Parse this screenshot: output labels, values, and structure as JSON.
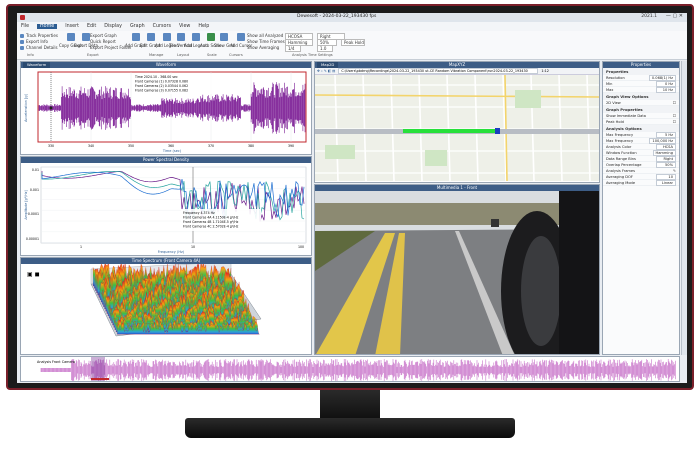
{
  "app": {
    "title": "Dewesoft - 2024-03-22_193430 fps",
    "version": "2021.1",
    "tabs": [
      "File",
      "Home",
      "Insert",
      "Edit",
      "Display",
      "Graph",
      "Cursors",
      "View",
      "Help"
    ],
    "active_tab": "Home"
  },
  "ribbon": {
    "items": [
      "Track Properties",
      "Export Info",
      "Channel Details",
      "Copy Graph",
      "Export Data",
      "Export Graph",
      "Quick Report",
      "Export Project Folder",
      "Add Graph",
      "Edit Graph",
      "Add Legend",
      "Tile Vertical",
      "Add Legend",
      "Auto Scale",
      "Show Grid",
      "Add Cursor",
      "Show all Analyzed Data",
      "Show Time Frames",
      "Show Averaging"
    ],
    "groups": [
      "Info",
      "Export",
      "Manage",
      "Layout",
      "Scale",
      "Cursors",
      "Analysis Time Settings"
    ],
    "dropdowns": [
      "HCOSA",
      "Right",
      "Hamming",
      "50%",
      "Peak Hold",
      "1/4",
      "1.0"
    ]
  },
  "panels": {
    "waveform": {
      "tab": "Waveform",
      "title": "Waveform",
      "ylabel": "Acceleration [g]",
      "xlabel": "Time (sec)",
      "xticks": [
        "330",
        "340",
        "350",
        "360",
        "370",
        "380",
        "390"
      ],
      "info": [
        "Time     2024.10 - 368.00  sec",
        "Front Cameras (1)   0.07328     0.080",
        "Front Cameras (2)   0.03544     0.062",
        "Front Cameras (3)   0.07155     0.082"
      ]
    },
    "psd": {
      "title": "Power Spectral Density",
      "ylabel": "Amplitude [g²/Hz]",
      "xlabel": "Frequency (Hz)",
      "yticks": [
        "0.01",
        "0.001",
        "0.0001",
        "0.00001"
      ],
      "xticks": [
        "1",
        "10",
        "100"
      ],
      "info": [
        "Frequency          4.374 Hz",
        "Front Cameras 4A   4.1150E-4  g²/Hz",
        "Front Cameras 4B   1.7104E-5  g²/Hz",
        "Front Cameras 4C   2.5702E-4  g²/Hz"
      ]
    },
    "waterfall": {
      "title": "Time Spectrum (Front Camera 4A)"
    },
    "map": {
      "tab": "Map2D",
      "title": "MapXYZ",
      "path": "C:\\Users\\pbdrng\\Recordings\\2024-03-22_193430 ut-CE Random Vibration Component\\run2024-03-22_193430",
      "zoom": "1:12"
    },
    "video": {
      "title": "Multimedia 1 - Front"
    },
    "overview": {
      "label": "Analysis Front Camera"
    }
  },
  "properties": {
    "title": "Properties",
    "sections": [
      {
        "name": "Properties",
        "rows": [
          [
            "Resolution",
            "0.068(1) Hz"
          ],
          [
            "Min",
            "0 Hz"
          ],
          [
            "Max",
            "10 Hz"
          ]
        ]
      },
      {
        "name": "Graph View Options",
        "rows": [
          [
            "2D View",
            ""
          ]
        ]
      },
      {
        "name": "Graph Properties",
        "rows": [
          [
            "Show Immediate Data",
            ""
          ],
          [
            "Peak Hold",
            ""
          ]
        ]
      },
      {
        "name": "Analysis Options",
        "rows": [
          [
            "Max Frequency",
            "5 Hz"
          ],
          [
            "Max Frequency",
            "100,000 Hz"
          ],
          [
            "Analysis Color",
            "HCSA"
          ],
          [
            "Window Function",
            "Hamming"
          ],
          [
            "Data Range Bins",
            "Right"
          ],
          [
            "Overlap Percentage",
            "50%"
          ],
          [
            "Analysis Frames",
            ""
          ],
          [
            "Averaging DOF",
            "10"
          ],
          [
            "Averaging Mode",
            "Linear"
          ]
        ]
      }
    ]
  }
}
